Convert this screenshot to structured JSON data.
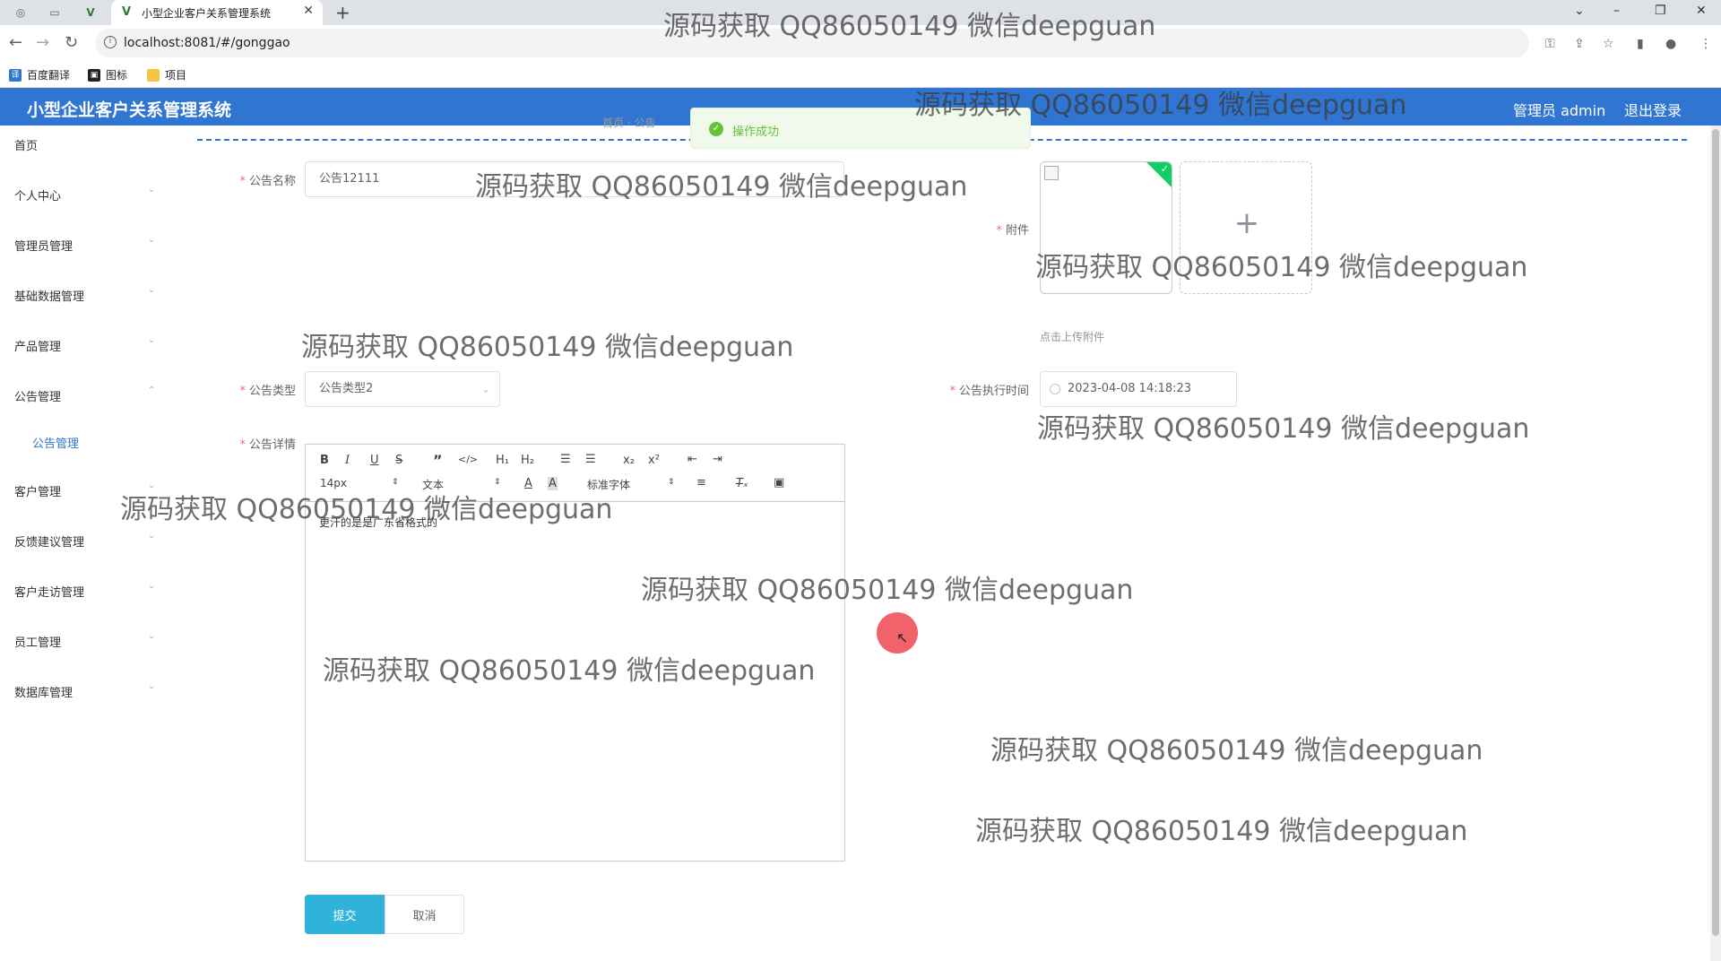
{
  "browser": {
    "tab_title": "小型企业客户关系管理系统",
    "url": "localhost:8081/#/gonggao",
    "bookmarks": [
      "百度翻译",
      "图标",
      "项目"
    ]
  },
  "header": {
    "title": "小型企业客户关系管理系统",
    "admin": "管理员 admin",
    "logout": "退出登录"
  },
  "sidebar": {
    "items": [
      {
        "label": "首页"
      },
      {
        "label": "个人中心"
      },
      {
        "label": "管理员管理"
      },
      {
        "label": "基础数据管理"
      },
      {
        "label": "产品管理"
      },
      {
        "label": "公告管理"
      },
      {
        "label": "公告管理"
      },
      {
        "label": "客户管理"
      },
      {
        "label": "反馈建议管理"
      },
      {
        "label": "客户走访管理"
      },
      {
        "label": "员工管理"
      },
      {
        "label": "数据库管理"
      }
    ]
  },
  "breadcrumb": "首页 · 公告",
  "toast": {
    "message": "操作成功"
  },
  "form": {
    "name_label": "公告名称",
    "name_value": "公告12111",
    "attachment_label": "附件",
    "upload_tip": "点击上传附件",
    "type_label": "公告类型",
    "type_value": "公告类型2",
    "time_label": "公告执行时间",
    "time_value": "2023-04-08 14:18:23",
    "detail_label": "公告详情",
    "editor": {
      "font_size": "14px",
      "format": "文本",
      "font_family": "标准字体",
      "content": "更汗的是是广东省格式的"
    },
    "submit": "提交",
    "cancel": "取消"
  },
  "watermark": "源码获取 QQ86050149 微信deepguan"
}
